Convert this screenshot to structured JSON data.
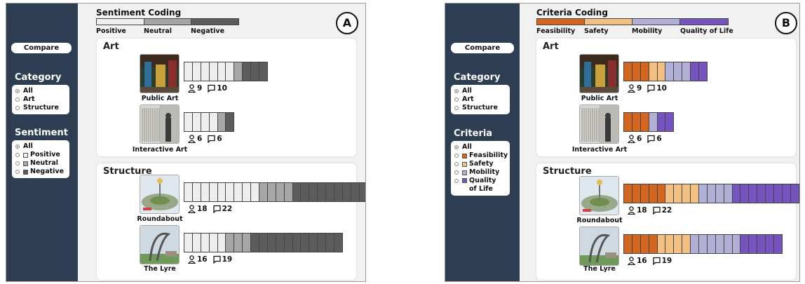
{
  "colors": {
    "sidebar": "#2d3e53",
    "positive": "#eeeeee",
    "neutral": "#a6a6a6",
    "negative": "#5c5c5c",
    "feasibility": "#d4651f",
    "safety": "#f2c083",
    "mobility": "#b3b0d8",
    "quality_of_life": "#7654c0"
  },
  "panelA": {
    "badge": "A",
    "legend": {
      "title": "Sentiment Coding",
      "labels": [
        "Positive",
        "Neutral",
        "Negative"
      ]
    },
    "sidebar": {
      "compare_label": "Compare",
      "category": {
        "title": "Category",
        "options": [
          "All",
          "Art",
          "Structure"
        ],
        "selected": "All"
      },
      "filter": {
        "title": "Sentiment",
        "options": [
          "All",
          "Positive",
          "Neutral",
          "Negative"
        ],
        "selected": "All"
      }
    },
    "groups": [
      {
        "title": "Art",
        "items": [
          {
            "name": "Public Art",
            "people": "9",
            "comments": "10",
            "counts": [
              6,
              1,
              3
            ]
          },
          {
            "name": "Interactive Art",
            "people": "6",
            "comments": "6",
            "counts": [
              4,
              1,
              1
            ]
          }
        ]
      },
      {
        "title": "Structure",
        "items": [
          {
            "name": "Roundabout",
            "people": "18",
            "comments": "22",
            "counts": [
              9,
              4,
              9
            ]
          },
          {
            "name": "The Lyre",
            "people": "16",
            "comments": "19",
            "counts": [
              5,
              3,
              11
            ]
          }
        ]
      }
    ]
  },
  "panelB": {
    "badge": "B",
    "legend": {
      "title": "Criteria Coding",
      "labels": [
        "Feasibility",
        "Safety",
        "Mobility",
        "Quality of Life"
      ]
    },
    "sidebar": {
      "compare_label": "Compare",
      "category": {
        "title": "Category",
        "options": [
          "All",
          "Art",
          "Structure"
        ],
        "selected": "All"
      },
      "filter": {
        "title": "Criteria",
        "options": [
          "All",
          "Feasibility",
          "Safety",
          "Mobility",
          "Quality of Life"
        ],
        "selected": "All"
      }
    },
    "groups": [
      {
        "title": "Art",
        "items": [
          {
            "name": "Public Art",
            "people": "9",
            "comments": "10",
            "counts": [
              3,
              2,
              3,
              2
            ]
          },
          {
            "name": "Interactive Art",
            "people": "6",
            "comments": "6",
            "counts": [
              3,
              0,
              1,
              2
            ]
          }
        ]
      },
      {
        "title": "Structure",
        "items": [
          {
            "name": "Roundabout",
            "people": "18",
            "comments": "22",
            "counts": [
              5,
              4,
              4,
              9
            ]
          },
          {
            "name": "The Lyre",
            "people": "16",
            "comments": "19",
            "counts": [
              4,
              4,
              6,
              5
            ]
          }
        ]
      }
    ]
  }
}
